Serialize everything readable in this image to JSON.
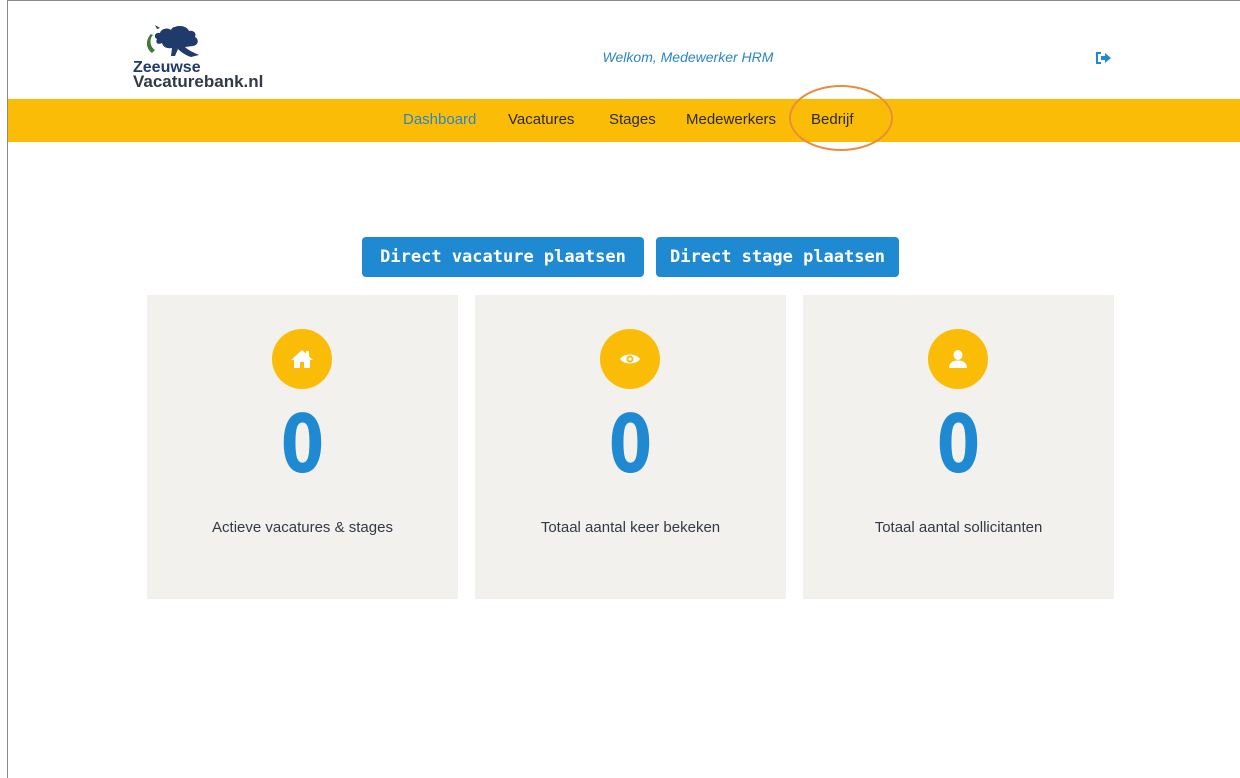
{
  "brand": {
    "logo_line1": "Zeeuwse",
    "logo_line2": "Vacaturebank.nl"
  },
  "header": {
    "welcome": "Welkom, Medewerker HRM",
    "logout_icon": "sign-out-icon"
  },
  "nav": {
    "items": [
      {
        "label": "Dashboard",
        "active": true
      },
      {
        "label": "Vacatures",
        "active": false
      },
      {
        "label": "Stages",
        "active": false
      },
      {
        "label": "Medewerkers",
        "active": false
      },
      {
        "label": "Bedrijf",
        "active": false
      }
    ]
  },
  "actions": {
    "post_vacancy": "Direct vacature plaatsen",
    "post_internship": "Direct stage plaatsen"
  },
  "stats": [
    {
      "icon": "home-icon",
      "value": "0",
      "label": "Actieve vacatures & stages"
    },
    {
      "icon": "eye-icon",
      "value": "0",
      "label": "Totaal aantal keer bekeken"
    },
    {
      "icon": "user-icon",
      "value": "0",
      "label": "Totaal aantal sollicitanten"
    }
  ],
  "colors": {
    "accent_yellow": "#fbbc07",
    "primary_blue": "#1f8ad2",
    "card_bg": "#f2f1ee",
    "annotation_orange": "#e88e3a"
  }
}
